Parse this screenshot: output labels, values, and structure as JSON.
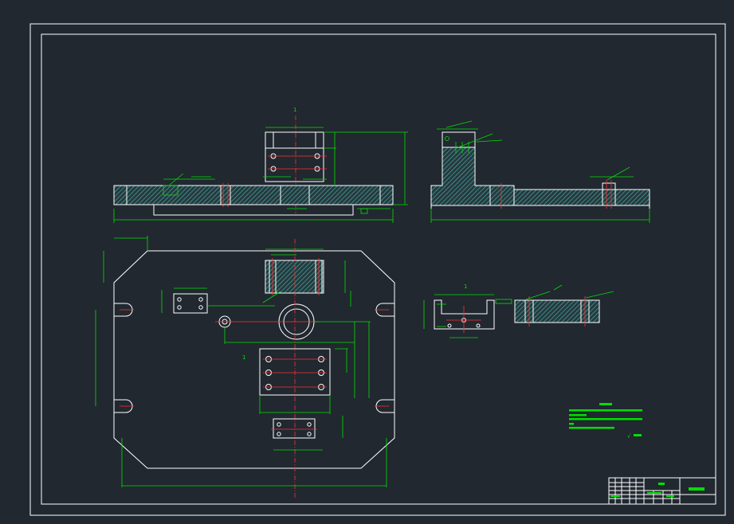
{
  "drawing": {
    "section_marks": [
      "1",
      "1"
    ],
    "detail_label": "1",
    "roughness_symbol": "√"
  },
  "colors": {
    "background": "#212830",
    "outline": "#ffffff",
    "dimension": "#00e000",
    "centerline": "#ff3030",
    "hatch": "#4aa6a6"
  }
}
